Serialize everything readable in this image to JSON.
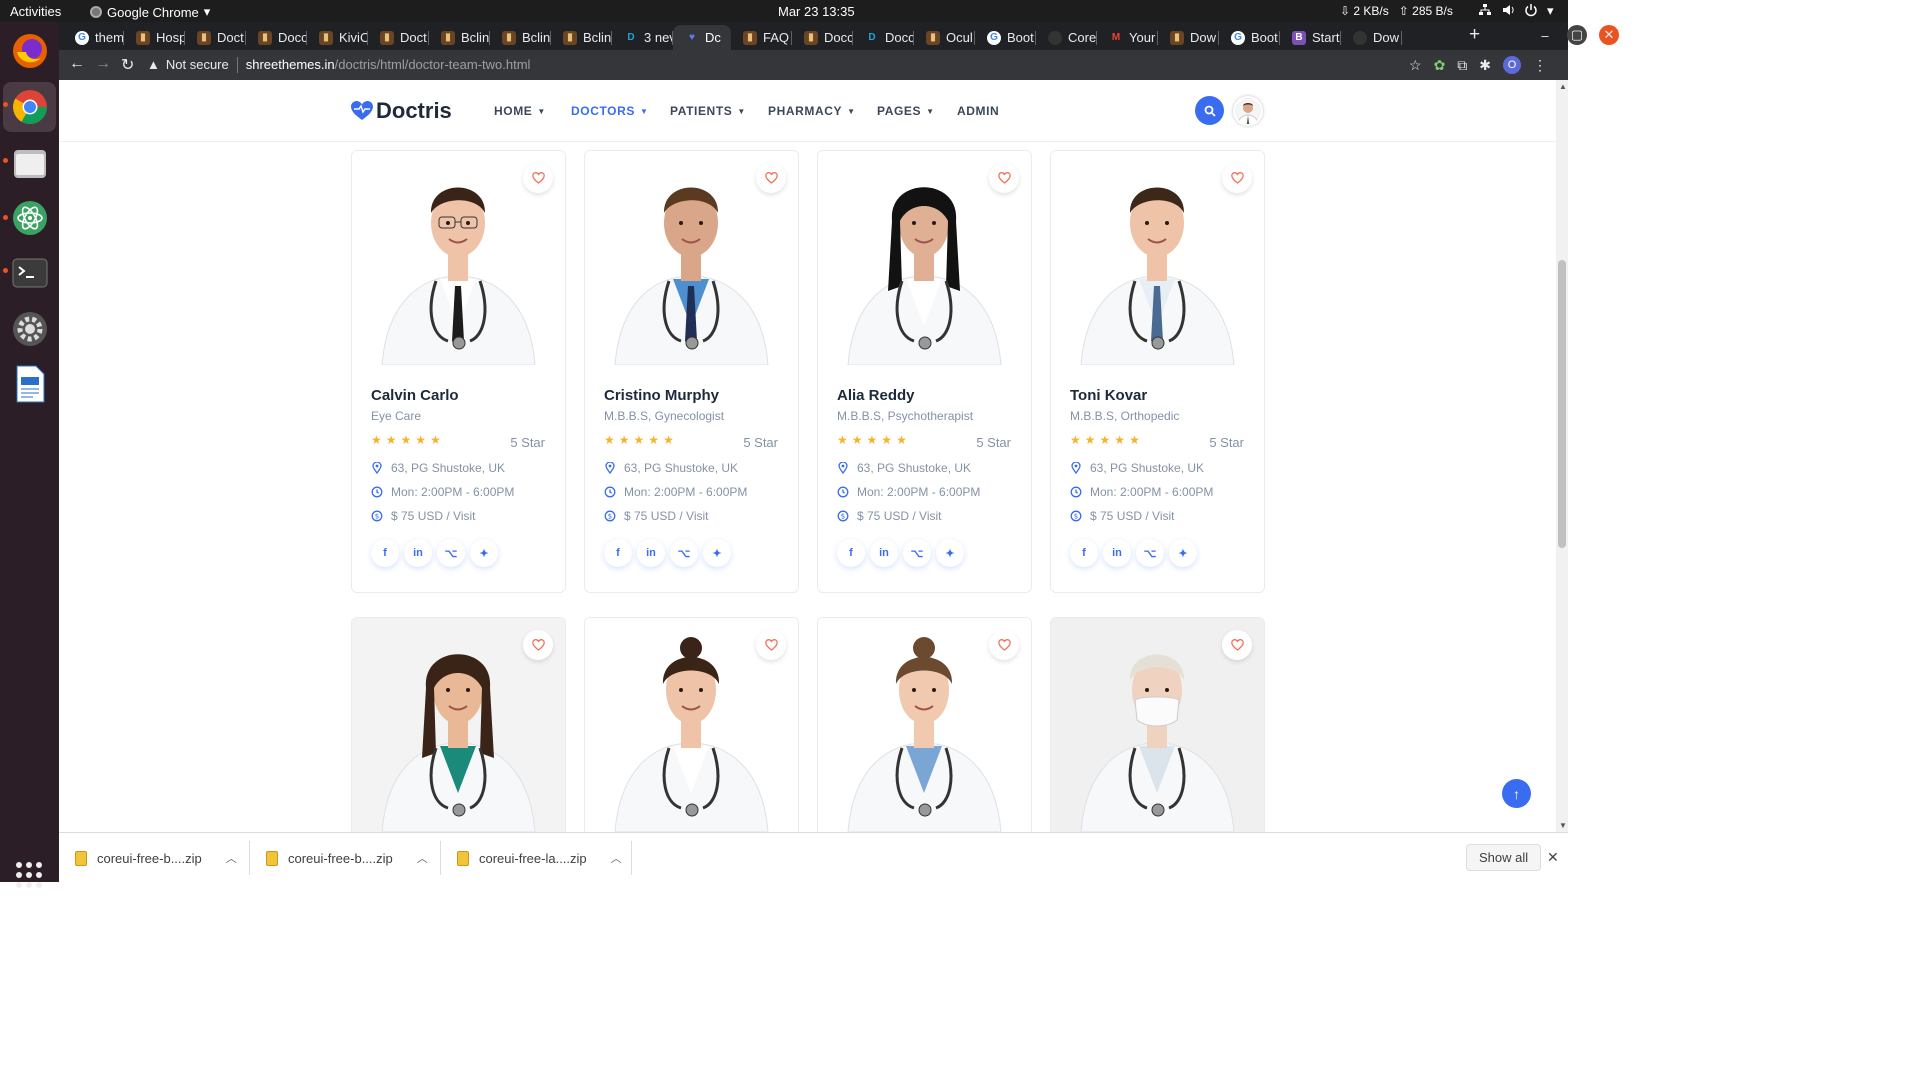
{
  "os": {
    "activities": "Activities",
    "app_menu": "Google Chrome",
    "clock": "Mar 23  13:35",
    "net_down": "2 KB/s",
    "net_up": "285 B/s"
  },
  "browser": {
    "tabs": [
      {
        "label": "them",
        "icon": "google-icon"
      },
      {
        "label": "Hosp",
        "icon": "page-icon"
      },
      {
        "label": "Doct",
        "icon": "page-icon"
      },
      {
        "label": "Docc",
        "icon": "page-icon"
      },
      {
        "label": "KiviC",
        "icon": "page-icon"
      },
      {
        "label": "Doct",
        "icon": "page-icon"
      },
      {
        "label": "Bclin",
        "icon": "page-icon"
      },
      {
        "label": "Bclin",
        "icon": "page-icon"
      },
      {
        "label": "Bclin",
        "icon": "page-icon"
      },
      {
        "label": "3 nev",
        "icon": "d-icon"
      },
      {
        "label": "Dc",
        "icon": "heart-icon",
        "active": true
      },
      {
        "label": "FAQ",
        "icon": "page-icon"
      },
      {
        "label": "Docc",
        "icon": "page-icon"
      },
      {
        "label": "Docc",
        "icon": "d-icon"
      },
      {
        "label": "Ocul",
        "icon": "page-icon"
      },
      {
        "label": "Boot",
        "icon": "google-icon"
      },
      {
        "label": "Core",
        "icon": "github-icon"
      },
      {
        "label": "Your",
        "icon": "gmail-icon"
      },
      {
        "label": "Dow",
        "icon": "page-icon"
      },
      {
        "label": "Boot",
        "icon": "google-icon"
      },
      {
        "label": "Start",
        "icon": "b-icon"
      },
      {
        "label": "Dow",
        "icon": "github-icon"
      }
    ],
    "security": "Not secure",
    "url_host": "shreethemes.in",
    "url_path": "/doctris/html/doctor-team-two.html",
    "profile_initial": "O"
  },
  "site": {
    "logo": "Doctris",
    "menu": [
      {
        "label": "HOME",
        "dropdown": true
      },
      {
        "label": "DOCTORS",
        "dropdown": true,
        "active": true
      },
      {
        "label": "PATIENTS",
        "dropdown": true
      },
      {
        "label": "PHARMACY",
        "dropdown": true
      },
      {
        "label": "PAGES",
        "dropdown": true
      },
      {
        "label": "ADMIN",
        "dropdown": false
      }
    ],
    "accent": "#396cf0"
  },
  "doctors": [
    {
      "name": "Calvin Carlo",
      "specialty": "Eye Care",
      "stars": 5,
      "rating": "5 Star",
      "location": "63, PG Shustoke, UK",
      "hours": "Mon: 2:00PM - 6:00PM",
      "fee": "$ 75 USD / Visit"
    },
    {
      "name": "Cristino Murphy",
      "specialty": "M.B.B.S, Gynecologist",
      "stars": 5,
      "rating": "5 Star",
      "location": "63, PG Shustoke, UK",
      "hours": "Mon: 2:00PM - 6:00PM",
      "fee": "$ 75 USD / Visit"
    },
    {
      "name": "Alia Reddy",
      "specialty": "M.B.B.S, Psychotherapist",
      "stars": 5,
      "rating": "5 Star",
      "location": "63, PG Shustoke, UK",
      "hours": "Mon: 2:00PM - 6:00PM",
      "fee": "$ 75 USD / Visit"
    },
    {
      "name": "Toni Kovar",
      "specialty": "M.B.B.S, Orthopedic",
      "stars": 5,
      "rating": "5 Star",
      "location": "63, PG Shustoke, UK",
      "hours": "Mon: 2:00PM - 6:00PM",
      "fee": "$ 75 USD / Visit"
    }
  ],
  "downloads": [
    {
      "name": "coreui-free-b....zip"
    },
    {
      "name": "coreui-free-b....zip"
    },
    {
      "name": "coreui-free-la....zip"
    }
  ],
  "download_bar": {
    "show_all": "Show all"
  }
}
